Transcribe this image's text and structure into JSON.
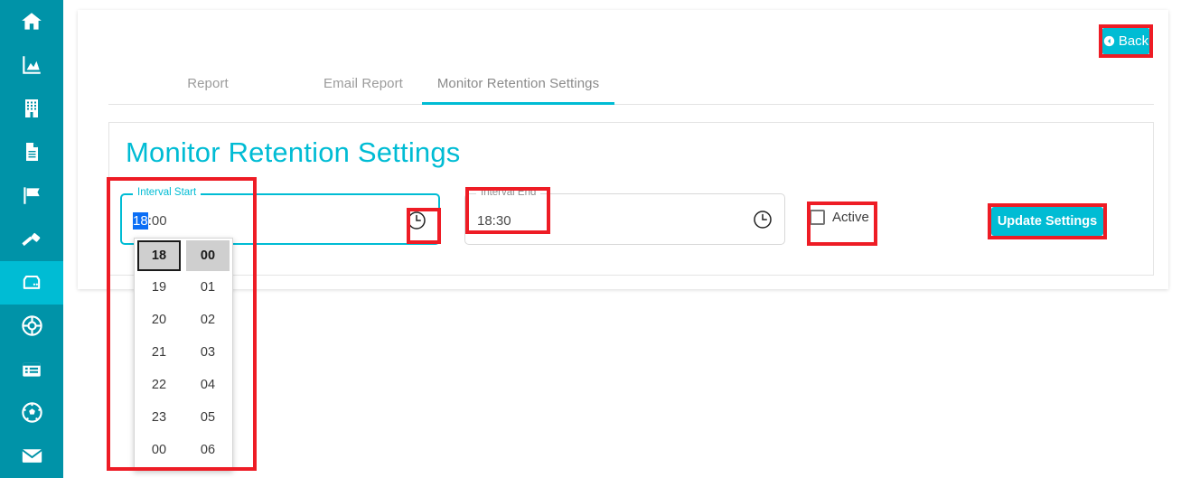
{
  "sidebar": {
    "items": [
      {
        "icon": "home-icon",
        "active": false
      },
      {
        "icon": "analytics-chart-icon",
        "active": false
      },
      {
        "icon": "building-icon",
        "active": false
      },
      {
        "icon": "document-icon",
        "active": false
      },
      {
        "icon": "flag-icon",
        "active": false
      },
      {
        "icon": "gavel-icon",
        "active": false
      },
      {
        "icon": "server-storage-icon",
        "active": true
      },
      {
        "icon": "lifebuoy-support-icon",
        "active": false
      },
      {
        "icon": "list-window-icon",
        "active": false
      },
      {
        "icon": "soccer-ball-icon",
        "active": false
      },
      {
        "icon": "envelope-mail-icon",
        "active": false
      }
    ]
  },
  "header": {
    "back_label": "Back"
  },
  "tabs": [
    {
      "label": "Report",
      "active": false
    },
    {
      "label": "Email Report",
      "active": false
    },
    {
      "label": "Monitor Retention Settings",
      "active": true
    }
  ],
  "card": {
    "title": "Monitor Retention Settings"
  },
  "form": {
    "interval_start": {
      "legend": "Interval Start",
      "value_selected": "18",
      "value_rest": ":00",
      "clock_icon": "clock-icon"
    },
    "interval_end": {
      "legend": "Interval End",
      "value": "18:30",
      "clock_icon": "clock-icon"
    },
    "active_checkbox": {
      "label": "Active",
      "checked": false
    },
    "update_button": {
      "label": "Update Settings"
    }
  },
  "time_dropdown": {
    "hours": [
      "18",
      "19",
      "20",
      "21",
      "22",
      "23",
      "00"
    ],
    "minutes": [
      "00",
      "01",
      "02",
      "03",
      "04",
      "05",
      "06"
    ],
    "selected_hour": "18",
    "selected_minute": "00"
  },
  "colors": {
    "sidebar": "#0093a8",
    "sidebar_active": "#00bcd4",
    "accent": "#00bcd4",
    "annotation": "#ee1c25",
    "text_selection": "#0b6ef5"
  }
}
